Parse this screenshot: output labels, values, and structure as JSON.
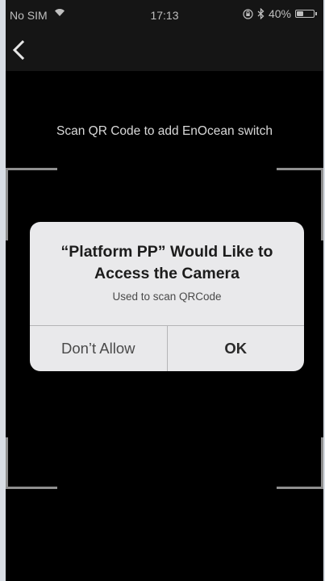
{
  "status_bar": {
    "carrier": "No SIM",
    "time": "17:13",
    "battery_percent": "40%",
    "battery_level": 0.4,
    "icons": [
      "wifi-icon",
      "orientation-lock-icon",
      "bluetooth-icon",
      "battery-icon"
    ]
  },
  "nav": {
    "back_icon": "chevron-left-icon"
  },
  "scanner": {
    "instruction": "Scan QR Code to add EnOcean switch"
  },
  "alert": {
    "title": "“Platform PP” Would Like to Access the Camera",
    "message": "Used to scan QRCode",
    "deny_label": "Don’t Allow",
    "ok_label": "OK"
  },
  "colors": {
    "background": "#000000",
    "bar": "#151515",
    "frame_corner": "#8f8f8f",
    "alert_bg": "#e9e9eb"
  }
}
